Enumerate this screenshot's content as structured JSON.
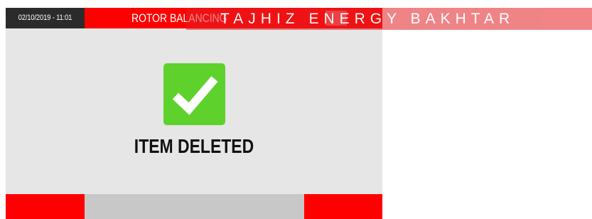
{
  "header": {
    "datetime": "02/10/2019 - 11:01",
    "title": "ROTOR BALANCING"
  },
  "dialog": {
    "icon": "checkmark-icon",
    "message": "ITEM DELETED"
  },
  "watermark": {
    "text": "TAJHIZ ENERGY BAKHTAR"
  },
  "colors": {
    "header_red": "#ff0000",
    "datetime_bg": "#2b2b2b",
    "panel_bg": "#e6e6e6",
    "success_green": "#5fd12c",
    "bottom_bar": "#c8c8c8",
    "watermark": "#e42026"
  }
}
